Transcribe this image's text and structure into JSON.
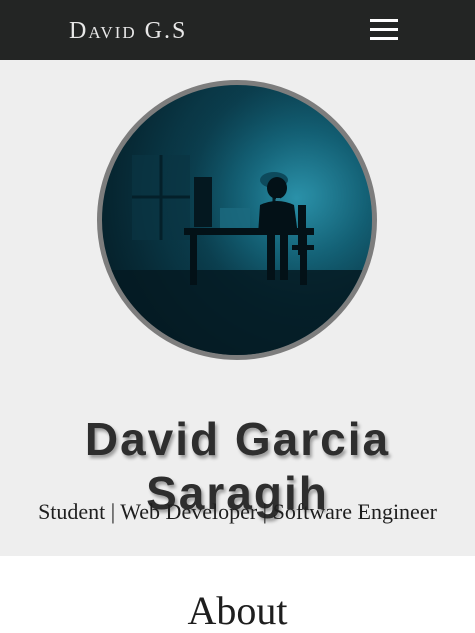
{
  "navbar": {
    "brand": "David G.S",
    "menu_icon": "hamburger-menu-icon"
  },
  "hero": {
    "avatar_alt": "profile-photo",
    "name_line1": "David Garcia",
    "name_line2": "Saragih",
    "tagline": "Student | Web Developer | Software Engineer"
  },
  "about": {
    "title": "About"
  },
  "colors": {
    "navbar_bg": "#232524",
    "hero_bg": "#eeeeee",
    "avatar_border": "#7d7d7d",
    "text_dark": "#2e2e2e"
  }
}
